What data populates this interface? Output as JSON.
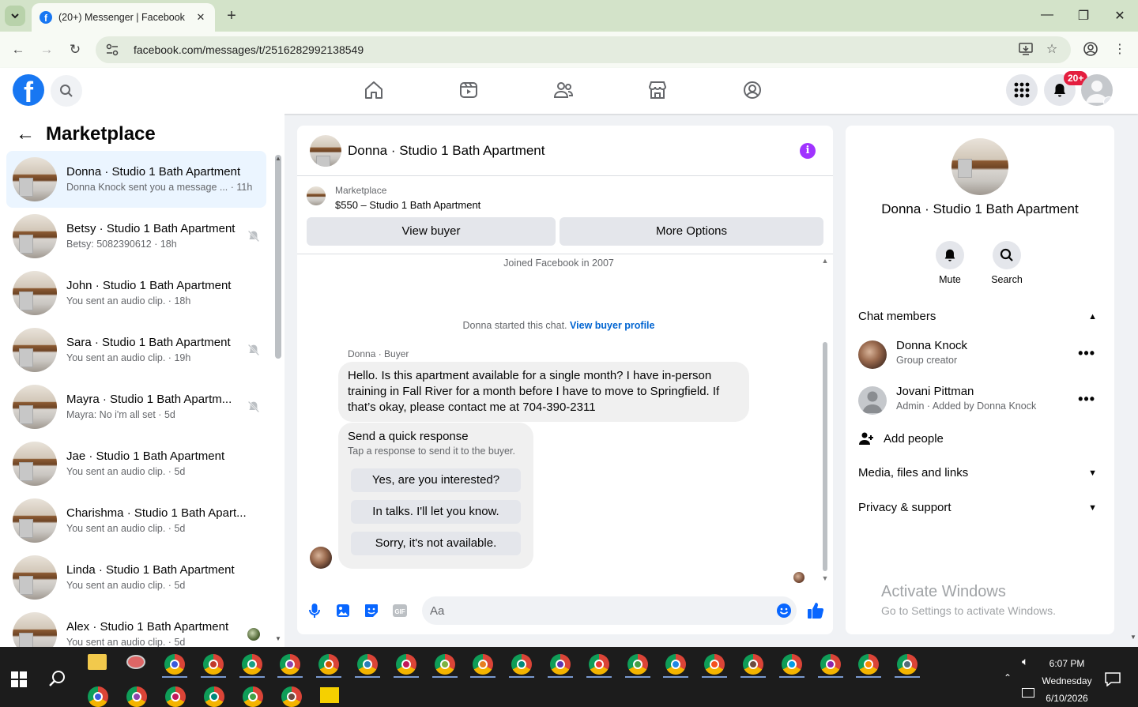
{
  "browser": {
    "tab_title": "(20+) Messenger | Facebook",
    "url": "facebook.com/messages/t/2516282992138549"
  },
  "nav": {
    "notifications_badge": "20+"
  },
  "left": {
    "title": "Marketplace",
    "conversations": [
      {
        "name": "Donna · Studio 1 Bath Apartment",
        "sub": "Donna Knock sent you a message ... · 11h",
        "muted": false,
        "active": true
      },
      {
        "name": "Betsy · Studio 1 Bath Apartment",
        "sub": "Betsy: 5082390612 · 18h",
        "muted": true
      },
      {
        "name": "John · Studio 1 Bath Apartment",
        "sub": "You sent an audio clip. · 18h",
        "muted": false
      },
      {
        "name": "Sara · Studio 1 Bath Apartment",
        "sub": "You sent an audio clip. · 19h",
        "muted": true
      },
      {
        "name": "Mayra · Studio 1 Bath Apartm...",
        "sub": "Mayra: No i'm all set · 5d",
        "muted": true
      },
      {
        "name": "Jae · Studio 1 Bath Apartment",
        "sub": "You sent an audio clip. · 5d",
        "muted": false
      },
      {
        "name": "Charishma · Studio 1 Bath Apart...",
        "sub": "You sent an audio clip. · 5d",
        "muted": false
      },
      {
        "name": "Linda · Studio 1 Bath Apartment",
        "sub": "You sent an audio clip. · 5d",
        "muted": false
      },
      {
        "name": "Alex · Studio 1 Bath Apartment",
        "sub": "You sent an audio clip. · 5d",
        "muted": false
      }
    ]
  },
  "chat": {
    "title": "Donna · Studio 1 Bath Apartment",
    "marketplace_label": "Marketplace",
    "listing": "$550 – Studio 1 Bath Apartment",
    "view_buyer": "View buyer",
    "more_options": "More Options",
    "joined": "Joined Facebook in 2007",
    "started_text": "Donna started this chat.",
    "view_profile": "View buyer profile",
    "sender_label": "Donna · Buyer",
    "message": "Hello. Is this apartment available for a single month? I have in-person training in Fall River for a month before I have to move to Springfield. If that’s okay, please contact me at 704-390-2311",
    "quick_title": "Send a quick response",
    "quick_sub": "Tap a response to send it to the buyer.",
    "quick_responses": [
      "Yes, are you interested?",
      "In talks. I'll let you know.",
      "Sorry, it's not available."
    ],
    "input_placeholder": "Aa"
  },
  "info": {
    "name": "Donna · Studio 1 Bath Apartment",
    "mute_label": "Mute",
    "search_label": "Search",
    "chat_members": "Chat members",
    "members": [
      {
        "name": "Donna Knock",
        "role": "Group creator"
      },
      {
        "name": "Jovani Pittman",
        "role": "Admin · Added by Donna Knock"
      }
    ],
    "add_people": "Add people",
    "media": "Media, files and links",
    "privacy": "Privacy & support"
  },
  "watermark": {
    "line1": "Activate Windows",
    "line2": "Go to Settings to activate Windows."
  },
  "taskbar": {
    "time": "6:07 PM",
    "day": "Wednesday",
    "date": "6/10/2026"
  },
  "colors": {
    "facebook_blue": "#1877f2",
    "badge_red": "#e41e3f",
    "info_purple": "#a033ff",
    "link_blue": "#0064d1",
    "active_row": "#ebf5ff"
  }
}
